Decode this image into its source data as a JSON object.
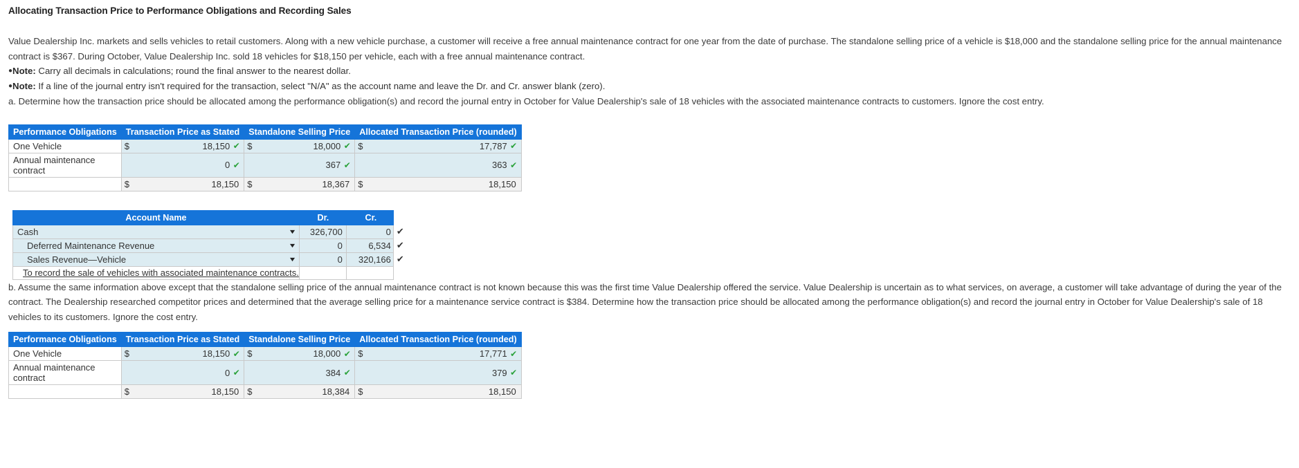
{
  "title": "Allocating Transaction Price to Performance Obligations and Recording Sales",
  "intro": "Value Dealership Inc. markets and sells vehicles to retail customers. Along with a new vehicle purchase, a customer will receive a free annual maintenance contract for one year from the date of purchase. The standalone selling price of a vehicle is $18,000 and the standalone selling price for the annual maintenance contract is $367. During October, Value Dealership Inc. sold 18 vehicles for $18,150 per vehicle, each with a free annual maintenance contract.",
  "notes": [
    {
      "label": "Note:",
      "text": "Carry all decimals in calculations; round the final answer to the nearest dollar."
    },
    {
      "label": "Note:",
      "text": "If a line of the journal entry isn't required for the transaction, select \"N/A\" as the account name and leave the Dr. and Cr. answer blank (zero)."
    }
  ],
  "part_a": {
    "prompt": "a. Determine how the transaction price should be allocated among the performance obligation(s) and record the journal entry in October for Value Dealership's sale of 18 vehicles with the associated maintenance contracts to customers. Ignore the cost entry.",
    "table": {
      "headers": [
        "Performance Obligations",
        "Transaction Price as Stated",
        "Standalone Selling Price",
        "Allocated Transaction Price (rounded)"
      ],
      "rows": [
        {
          "label": "One Vehicle",
          "stated_symbol": "$",
          "stated": "18,150",
          "stated_tick": "✔",
          "standalone_symbol": "$",
          "standalone": "18,000",
          "standalone_tick": "✔",
          "allocated_symbol": "$",
          "allocated": "17,787",
          "allocated_tick": "✔"
        },
        {
          "label": "Annual maintenance contract",
          "stated_symbol": "",
          "stated": "0",
          "stated_tick": "✔",
          "standalone_symbol": "",
          "standalone": "367",
          "standalone_tick": "✔",
          "allocated_symbol": "",
          "allocated": "363",
          "allocated_tick": "✔"
        }
      ],
      "total": {
        "label": "",
        "stated_symbol": "$",
        "stated": "18,150",
        "standalone_symbol": "$",
        "standalone": "18,367",
        "allocated_symbol": "$",
        "allocated": "18,150"
      }
    },
    "journal": {
      "headers": [
        "Account Name",
        "Dr.",
        "Cr."
      ],
      "rows": [
        {
          "account": "Cash",
          "dr": "326,700",
          "cr": "0",
          "tick": "✔",
          "indent": 0
        },
        {
          "account": "Deferred Maintenance Revenue",
          "dr": "0",
          "cr": "6,534",
          "tick": "✔",
          "indent": 1
        },
        {
          "account": "Sales Revenue—Vehicle",
          "dr": "0",
          "cr": "320,166",
          "tick": "✔",
          "indent": 1
        }
      ],
      "memo": "To record the sale of vehicles with associated maintenance contracts."
    }
  },
  "part_b": {
    "prompt": "b. Assume the same information above except that the standalone selling price of the annual maintenance contract is not known because this was the first time Value Dealership offered the service. Value Dealership is uncertain as to what services, on average, a customer will take advantage of during the year of the contract. The Dealership researched competitor prices and determined that the average selling price for a maintenance service contract is $384. Determine how the transaction price should be allocated among the performance obligation(s) and record the journal entry in October for Value Dealership's sale of 18 vehicles to its customers. Ignore the cost entry.",
    "table": {
      "headers": [
        "Performance Obligations",
        "Transaction Price as Stated",
        "Standalone Selling Price",
        "Allocated Transaction Price (rounded)"
      ],
      "rows": [
        {
          "label": "One Vehicle",
          "stated_symbol": "$",
          "stated": "18,150",
          "stated_tick": "✔",
          "standalone_symbol": "$",
          "standalone": "18,000",
          "standalone_tick": "✔",
          "allocated_symbol": "$",
          "allocated": "17,771",
          "allocated_tick": "✔"
        },
        {
          "label": "Annual maintenance contract",
          "stated_symbol": "",
          "stated": "0",
          "stated_tick": "✔",
          "standalone_symbol": "",
          "standalone": "384",
          "standalone_tick": "✔",
          "allocated_symbol": "",
          "allocated": "379",
          "allocated_tick": "✔"
        }
      ],
      "total": {
        "label": "",
        "stated_symbol": "$",
        "stated": "18,150",
        "standalone_symbol": "$",
        "standalone": "18,384",
        "allocated_symbol": "$",
        "allocated": "18,150"
      }
    }
  },
  "icons": {
    "check": "✔",
    "chevron_down": "⌄"
  },
  "colors": {
    "header_blue": "#1574d9",
    "cell_blue": "#dcecf2",
    "check_green": "#2aa23a",
    "total_gray": "#f2f2f2"
  }
}
